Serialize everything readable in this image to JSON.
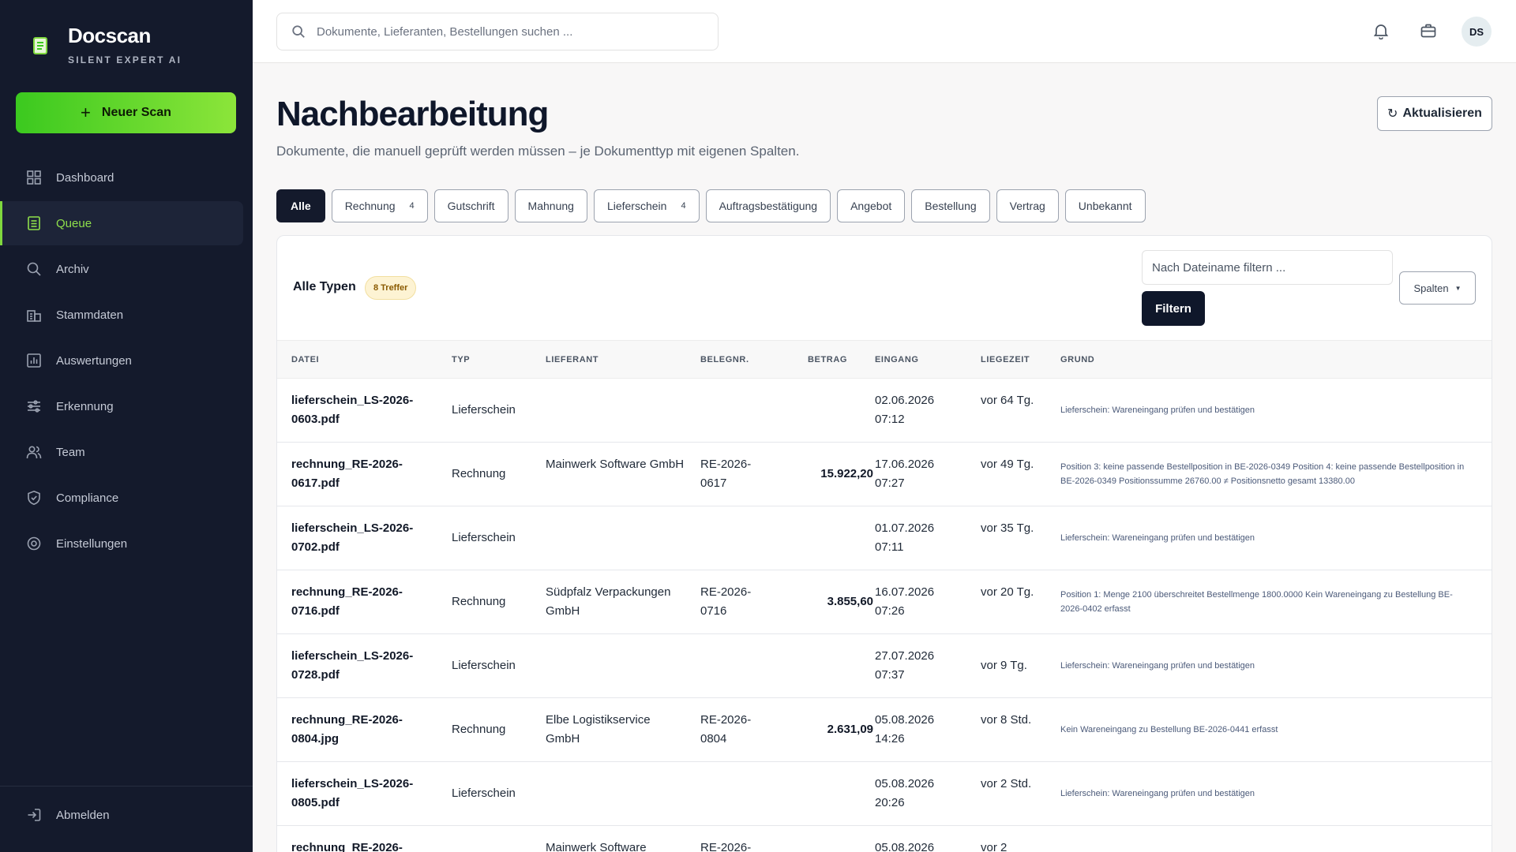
{
  "brand": {
    "name": "Docscan",
    "tagline": "SILENT EXPERT AI"
  },
  "sidebar": {
    "new_scan_label": "Neuer Scan",
    "items": [
      {
        "label": "Dashboard",
        "icon": "grid-icon",
        "active": false
      },
      {
        "label": "Queue",
        "icon": "list-icon",
        "active": true
      },
      {
        "label": "Archiv",
        "icon": "search-icon",
        "active": false
      },
      {
        "label": "Stammdaten",
        "icon": "building-icon",
        "active": false
      },
      {
        "label": "Auswertungen",
        "icon": "chart-icon",
        "active": false
      },
      {
        "label": "Erkennung",
        "icon": "sliders-icon",
        "active": false
      },
      {
        "label": "Team",
        "icon": "users-icon",
        "active": false
      },
      {
        "label": "Compliance",
        "icon": "shield-icon",
        "active": false
      },
      {
        "label": "Einstellungen",
        "icon": "gear-icon",
        "active": false
      }
    ],
    "logout_label": "Abmelden"
  },
  "topbar": {
    "search_placeholder": "Dokumente, Lieferanten, Bestellungen suchen ...",
    "avatar_initials": "DS"
  },
  "page": {
    "title": "Nachbearbeitung",
    "subtitle": "Dokumente, die manuell geprüft werden müssen – je Dokumenttyp mit eigenen Spalten.",
    "refresh_label": "Aktualisieren",
    "refresh_icon": "↻"
  },
  "tabs": [
    {
      "label": "Alle",
      "count": "",
      "active": true
    },
    {
      "label": "Rechnung",
      "count": "4",
      "active": false
    },
    {
      "label": "Gutschrift",
      "count": "",
      "active": false
    },
    {
      "label": "Mahnung",
      "count": "",
      "active": false
    },
    {
      "label": "Lieferschein",
      "count": "4",
      "active": false
    },
    {
      "label": "Auftragsbestätigung",
      "count": "",
      "active": false
    },
    {
      "label": "Angebot",
      "count": "",
      "active": false
    },
    {
      "label": "Bestellung",
      "count": "",
      "active": false
    },
    {
      "label": "Vertrag",
      "count": "",
      "active": false
    },
    {
      "label": "Unbekannt",
      "count": "",
      "active": false
    }
  ],
  "table": {
    "title": "Alle Typen",
    "hits_badge": "8 Treffer",
    "filter_placeholder": "Nach Dateiname filtern ...",
    "filter_button": "Filtern",
    "columns_button": "Spalten",
    "columns": [
      "DATEI",
      "TYP",
      "LIEFERANT",
      "BELEGNR.",
      "BETRAG",
      "EINGANG",
      "LIEGEZEIT",
      "GRUND"
    ],
    "rows": [
      {
        "file": "lieferschein_LS-2026-0603.pdf",
        "type": "Lieferschein",
        "supplier": "",
        "doc_no": "",
        "amount": "",
        "received": "02.06.2026 07:12",
        "age": "vor 64 Tg.",
        "reason": "Lieferschein: Wareneingang prüfen und bestätigen"
      },
      {
        "file": "rechnung_RE-2026-0617.pdf",
        "type": "Rechnung",
        "supplier": "Mainwerk Software GmbH",
        "doc_no": "RE-2026-0617",
        "amount": "15.922,20",
        "received": "17.06.2026 07:27",
        "age": "vor 49 Tg.",
        "reason": "Position 3: keine passende Bestellposition in BE-2026-0349 Position 4: keine passende Bestellposition in BE-2026-0349 Positionssumme 26760.00 ≠ Positionsnetto gesamt 13380.00"
      },
      {
        "file": "lieferschein_LS-2026-0702.pdf",
        "type": "Lieferschein",
        "supplier": "",
        "doc_no": "",
        "amount": "",
        "received": "01.07.2026 07:11",
        "age": "vor 35 Tg.",
        "reason": "Lieferschein: Wareneingang prüfen und bestätigen"
      },
      {
        "file": "rechnung_RE-2026-0716.pdf",
        "type": "Rechnung",
        "supplier": "Südpfalz Verpackungen GmbH",
        "doc_no": "RE-2026-0716",
        "amount": "3.855,60",
        "received": "16.07.2026 07:26",
        "age": "vor 20 Tg.",
        "reason": "Position 1: Menge 2100 überschreitet Bestellmenge 1800.0000 Kein Wareneingang zu Bestellung BE-2026-0402 erfasst"
      },
      {
        "file": "lieferschein_LS-2026-0728.pdf",
        "type": "Lieferschein",
        "supplier": "",
        "doc_no": "",
        "amount": "",
        "received": "27.07.2026 07:37",
        "age": "vor 9 Tg.",
        "reason": "Lieferschein: Wareneingang prüfen und bestätigen"
      },
      {
        "file": "rechnung_RE-2026-0804.jpg",
        "type": "Rechnung",
        "supplier": "Elbe Logistikservice GmbH",
        "doc_no": "RE-2026-0804",
        "amount": "2.631,09",
        "received": "05.08.2026 14:26",
        "age": "vor 8 Std.",
        "reason": "Kein Wareneingang zu Bestellung BE-2026-0441 erfasst"
      },
      {
        "file": "lieferschein_LS-2026-0805.pdf",
        "type": "Lieferschein",
        "supplier": "",
        "doc_no": "",
        "amount": "",
        "received": "05.08.2026 20:26",
        "age": "vor 2 Std.",
        "reason": "Lieferschein: Wareneingang prüfen und bestätigen"
      },
      {
        "file": "rechnung_RE-2026-",
        "type": "",
        "supplier": "Mainwerk Software",
        "doc_no": "RE-2026-",
        "amount": "",
        "received": "05.08.2026",
        "age": "vor 2",
        "reason": ""
      }
    ]
  },
  "colors": {
    "sidebar_bg": "#141a2c",
    "accent_green": "#8fe04b",
    "primary_dark": "#0f172a",
    "badge_bg": "#fdf3d3"
  }
}
